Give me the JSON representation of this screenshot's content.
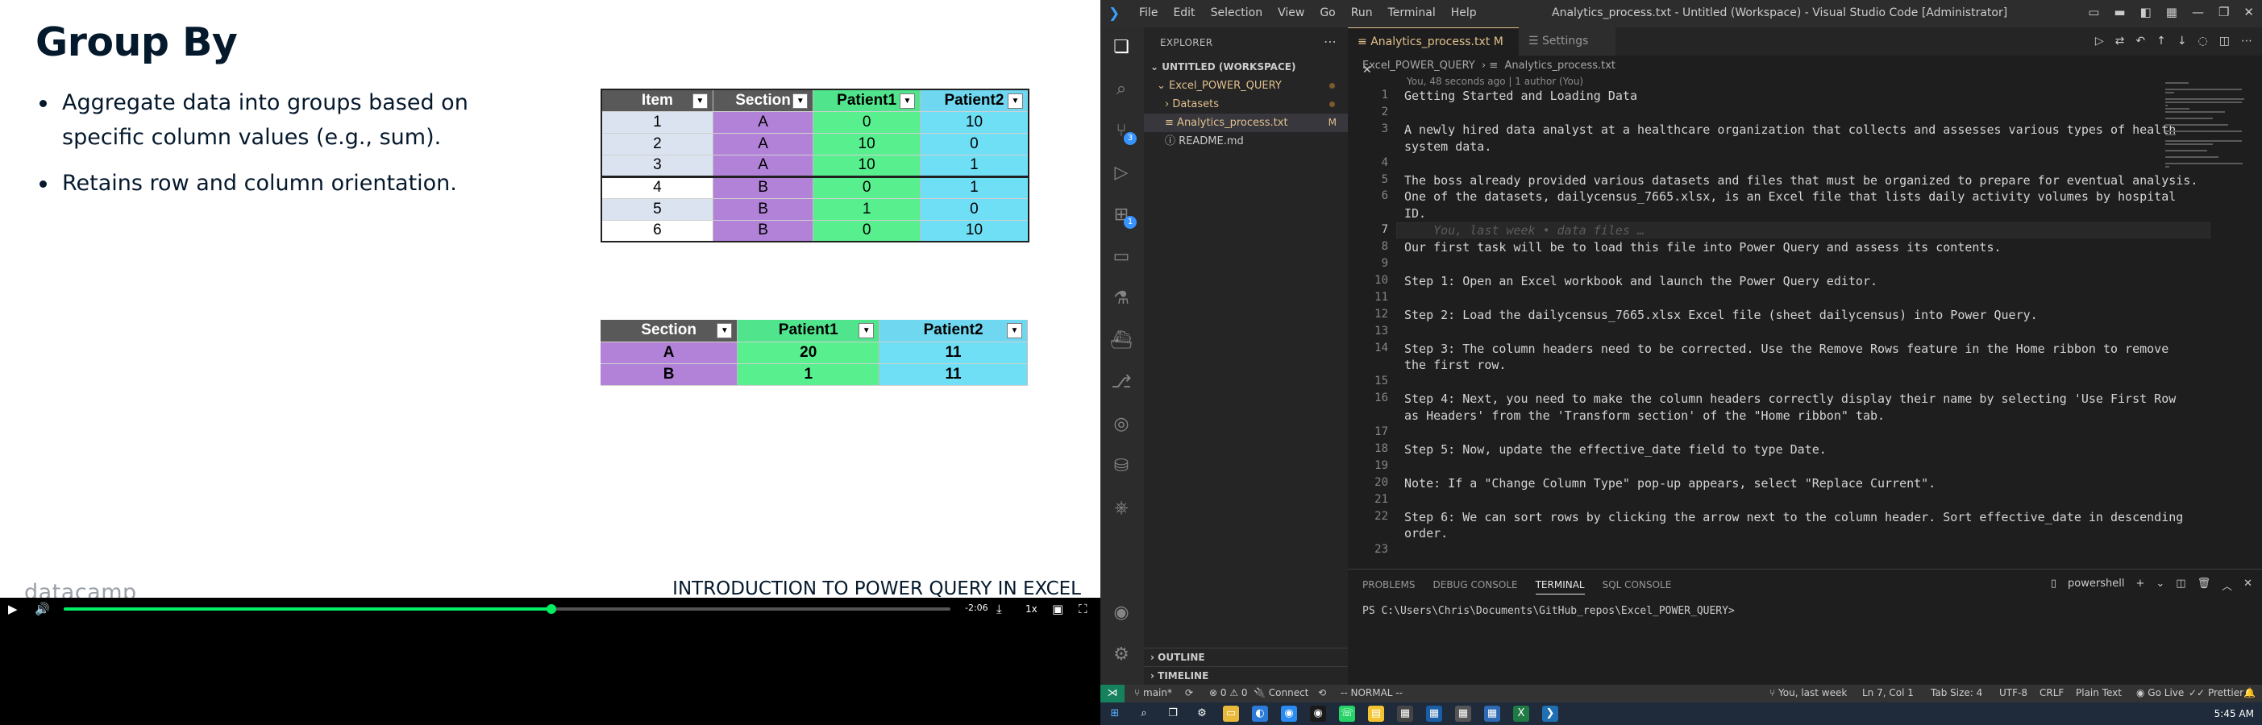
{
  "slide": {
    "title": "Group By",
    "bullets": [
      "Aggregate data into groups based on specific column values (e.g., sum).",
      "Retains row and column orientation."
    ],
    "table1": {
      "headers": [
        "Item",
        "Section",
        "Patient1",
        "Patient2"
      ],
      "rows": [
        [
          "1",
          "A",
          "0",
          "10"
        ],
        [
          "2",
          "A",
          "10",
          "0"
        ],
        [
          "3",
          "A",
          "10",
          "1"
        ],
        [
          "4",
          "B",
          "0",
          "1"
        ],
        [
          "5",
          "B",
          "1",
          "0"
        ],
        [
          "6",
          "B",
          "0",
          "10"
        ]
      ]
    },
    "table2": {
      "headers": [
        "Section",
        "Patient1",
        "Patient2"
      ],
      "rows": [
        [
          "A",
          "20",
          "11"
        ],
        [
          "B",
          "1",
          "11"
        ]
      ]
    },
    "footer_logo": "datacamp",
    "footer_text": "INTRODUCTION TO POWER QUERY IN EXCEL"
  },
  "player": {
    "progress": 0.55,
    "time_remaining": "-2:06",
    "speed": "1x"
  },
  "vscode": {
    "menu": [
      "File",
      "Edit",
      "Selection",
      "View",
      "Go",
      "Run",
      "Terminal",
      "Help"
    ],
    "window_title": "Analytics_process.txt - Untitled (Workspace) - Visual Studio Code [Administrator]",
    "explorer": {
      "header": "EXPLORER",
      "workspace": "UNTITLED (WORKSPACE)",
      "folder": "Excel_POWER_QUERY",
      "items": [
        {
          "label": "Datasets",
          "kind": "folder"
        },
        {
          "label": "Analytics_process.txt",
          "kind": "file",
          "status": "M"
        },
        {
          "label": "README.md",
          "kind": "file"
        }
      ],
      "outline": "OUTLINE",
      "timeline": "TIMELINE"
    },
    "tabs": [
      {
        "label": "Analytics_process.txt",
        "status": "M",
        "active": true
      },
      {
        "label": "Settings",
        "active": false
      }
    ],
    "breadcrumb": [
      "Excel_POWER_QUERY",
      "Analytics_process.txt"
    ],
    "blame": "You, 48 seconds ago | 1 author (You)",
    "lines": [
      {
        "n": "1",
        "text": "Getting Started and Loading Data"
      },
      {
        "n": "2",
        "text": ""
      },
      {
        "n": "3",
        "text": "A newly hired data analyst at a healthcare organization that collects and assesses various types of health"
      },
      {
        "n": "",
        "text": "system data."
      },
      {
        "n": "4",
        "text": ""
      },
      {
        "n": "5",
        "text": "The boss already provided various datasets and files that must be organized to prepare for eventual analysis."
      },
      {
        "n": "6",
        "text": "One of the datasets, dailycensus_7665.xlsx, is an Excel file that lists daily activity volumes by hospital"
      },
      {
        "n": "",
        "text": "ID."
      },
      {
        "n": "7",
        "text": "    You, last week • data files …",
        "ghost": true,
        "current": true
      },
      {
        "n": "8",
        "text": "Our first task will be to load this file into Power Query and assess its contents."
      },
      {
        "n": "9",
        "text": ""
      },
      {
        "n": "10",
        "text": "Step 1: Open an Excel workbook and launch the Power Query editor."
      },
      {
        "n": "11",
        "text": ""
      },
      {
        "n": "12",
        "text": "Step 2: Load the dailycensus_7665.xlsx Excel file (sheet dailycensus) into Power Query."
      },
      {
        "n": "13",
        "text": ""
      },
      {
        "n": "14",
        "text": "Step 3: The column headers need to be corrected. Use the Remove Rows feature in the Home ribbon to remove"
      },
      {
        "n": "",
        "text": "the first row."
      },
      {
        "n": "15",
        "text": ""
      },
      {
        "n": "16",
        "text": "Step 4: Next, you need to make the column headers correctly display their name by selecting 'Use First Row"
      },
      {
        "n": "",
        "text": "as Headers' from the 'Transform section' of the \"Home ribbon\" tab."
      },
      {
        "n": "17",
        "text": ""
      },
      {
        "n": "18",
        "text": "Step 5: Now, update the effective_date field to type Date."
      },
      {
        "n": "19",
        "text": ""
      },
      {
        "n": "20",
        "text": "Note: If a \"Change Column Type\" pop-up appears, select \"Replace Current\"."
      },
      {
        "n": "21",
        "text": ""
      },
      {
        "n": "22",
        "text": "Step 6: We can sort rows by clicking the arrow next to the column header. Sort effective_date in descending"
      },
      {
        "n": "",
        "text": "order."
      },
      {
        "n": "23",
        "text": ""
      }
    ],
    "panel": {
      "tabs": [
        "PROBLEMS",
        "DEBUG CONSOLE",
        "TERMINAL",
        "SQL CONSOLE"
      ],
      "active_tab": "TERMINAL",
      "shell": "powershell",
      "prompt": "PS C:\\Users\\Chris\\Documents\\GitHub_repos\\Excel_POWER_QUERY>"
    },
    "status": {
      "branch": "main*",
      "problems": "⊗ 0 ⚠ 0",
      "connect": "Connect",
      "mode": "-- NORMAL --",
      "blame": "You, last week",
      "position": "Ln 7, Col 1",
      "tab_size": "Tab Size: 4",
      "encoding": "UTF-8",
      "eol": "CRLF",
      "language": "Plain Text",
      "golive": "Go Live",
      "prettier": "Prettier"
    },
    "scm_badge": "3",
    "ext_badge": "1"
  },
  "taskbar": {
    "clock": "5:45 AM"
  },
  "colors": {
    "accent_green": "#03ef62",
    "vscode_bg": "#1e1e1e",
    "modified": "#e2c08d"
  }
}
